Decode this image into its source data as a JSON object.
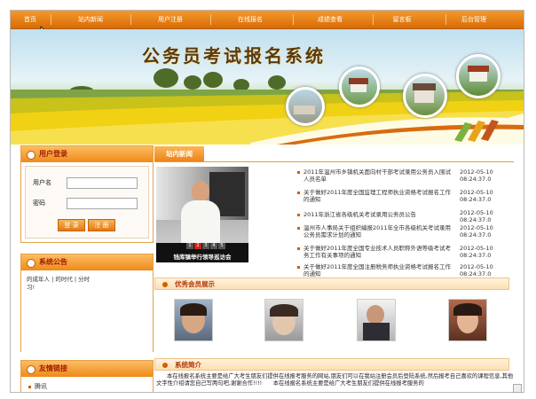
{
  "nav": {
    "items": [
      "首页",
      "站内新闻",
      "用户注册",
      "在线报名",
      "成绩查看",
      "留言板",
      "后台管理"
    ]
  },
  "banner": {
    "title": "公务员考试报名系统"
  },
  "login": {
    "title": "用户登录",
    "username_label": "用户名",
    "password_label": "密码",
    "login_button": "登 录",
    "register_button": "注 册"
  },
  "announcement": {
    "title": "系统公告",
    "text": "的成年人 | 的时代 | 分时",
    "text2": "习!"
  },
  "links": {
    "title": "友情链接",
    "items": [
      "腾讯"
    ]
  },
  "news": {
    "tab": "站内新闻",
    "photo_caption": "钱库镇举行领导巡访会",
    "pager": [
      "1",
      "2",
      "3",
      "4",
      "5"
    ],
    "items": [
      {
        "title": "2011年温州市乡镇机关面向村干部考试录用公务员入围试人员名单",
        "date": "2012-05-10",
        "time": "08:24:37.0"
      },
      {
        "title": "关于做好2011年度全国监理工程师执业资格考试报名工作的通知",
        "date": "2012-05-10",
        "time": "08:24:37.0"
      },
      {
        "title": "2011年浙江省各级机关考试录用公务员公告",
        "date": "2012-05-10",
        "time": "08:24:37.0"
      },
      {
        "title": "温州市人事局关于组织编报2011年全市各级机关考试录用公务员需求计划的通知",
        "date": "2012-05-10",
        "time": "08:24:37.0"
      },
      {
        "title": "关于做好2011年度全国专业技术人员职称外语等级考试考务工作有关事项的通知",
        "date": "2012-05-10",
        "time": "08:24:37.0"
      },
      {
        "title": "关于做好2011年度全国注册税务师执业资格考试报名工作的通知",
        "date": "2012-05-10",
        "time": "08:24:37.0"
      }
    ]
  },
  "members": {
    "title": "优秀会员展示"
  },
  "intro": {
    "title": "系统简介",
    "text": "本在线报名系统主要是给广大考生朋友们提供在线报考服务的网站,朋友们可以在我站注册会员后登陆系统,然后报考自己喜欢的课程信息,其他文字性介绍请您自己写两句吧,谢谢合作!!!!　　本在线报名系统主要是给广大考生朋友们提供在线报考服务的"
  },
  "colors": {
    "nav": "#e27b12",
    "accent": "#b3360a",
    "border": "#e6a04a"
  }
}
